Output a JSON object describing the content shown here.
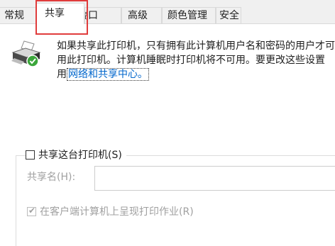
{
  "tabs": [
    {
      "label": "常规"
    },
    {
      "label": "共享"
    },
    {
      "label": "端口"
    },
    {
      "label": "高级"
    },
    {
      "label": "颜色管理"
    },
    {
      "label": "安全"
    }
  ],
  "info": {
    "line1": "如果共享此打印机，只有拥有此计算机用户名和密码的用户才可",
    "line2": "用此打印机。计算机睡眠时打印机将不可用。要更改这些设置",
    "line3_prefix": "用",
    "link": "网络和共享中心。"
  },
  "share": {
    "checkbox_label": "共享这台打印机(S)",
    "checked": false,
    "name_label": "共享名(H):",
    "name_value": ""
  },
  "render": {
    "checkbox_label": "在客户端计算机上呈现打印作业(R)",
    "checked": true,
    "enabled": false
  },
  "colors": {
    "link": "#0066cc",
    "highlight": "#e03c3c",
    "disabled_text": "#a0a0a0"
  },
  "icons": {
    "printer": "printer-share-icon",
    "check": "checkmark-icon"
  }
}
